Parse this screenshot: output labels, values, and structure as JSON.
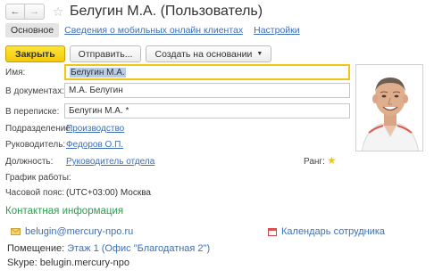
{
  "window": {
    "title": "Белугин М.А. (Пользователь)",
    "back_icon": "arrow-left-icon",
    "forward_icon": "arrow-right-icon",
    "favorite_icon": "star-outline-icon"
  },
  "tabs": [
    {
      "label": "Основное",
      "active": true
    },
    {
      "label": "Сведения о мобильных онлайн клиентах",
      "active": false
    },
    {
      "label": "Настройки",
      "active": false
    }
  ],
  "toolbar": {
    "close_label": "Закрыть",
    "send_label": "Отправить...",
    "create_label": "Создать на основании"
  },
  "form": {
    "name_label": "Имя:",
    "name_value": "Белугин М.А.",
    "docs_label": "В документах:",
    "docs_value": "М.А. Белугин",
    "correspondence_label": "В переписке:",
    "correspondence_value": "Белугин М.А. *",
    "department_label": "Подразделение:",
    "department_value": "Производство",
    "manager_label": "Руководитель:",
    "manager_value": "Федоров О.П.",
    "position_label": "Должность:",
    "position_value": "Руководитель отдела",
    "rank_label": "Ранг:",
    "schedule_label": "График работы:",
    "timezone_label": "Часовой пояс:",
    "timezone_value": "(UTC+03:00) Москва"
  },
  "contacts": {
    "section_title": "Контактная информация",
    "email": "belugin@mercury-npo.ru",
    "calendar_label": "Календарь сотрудника",
    "room_label": "Помещение:",
    "room_value": "Этаж 1 (Офис \"Благодатная 2\")",
    "skype_label": "Skype:",
    "skype_value": "belugin.mercury-npo"
  },
  "colors": {
    "accent_yellow": "#f3c90a",
    "link_blue": "#3d6fb4",
    "section_green": "#2e9b4e"
  }
}
